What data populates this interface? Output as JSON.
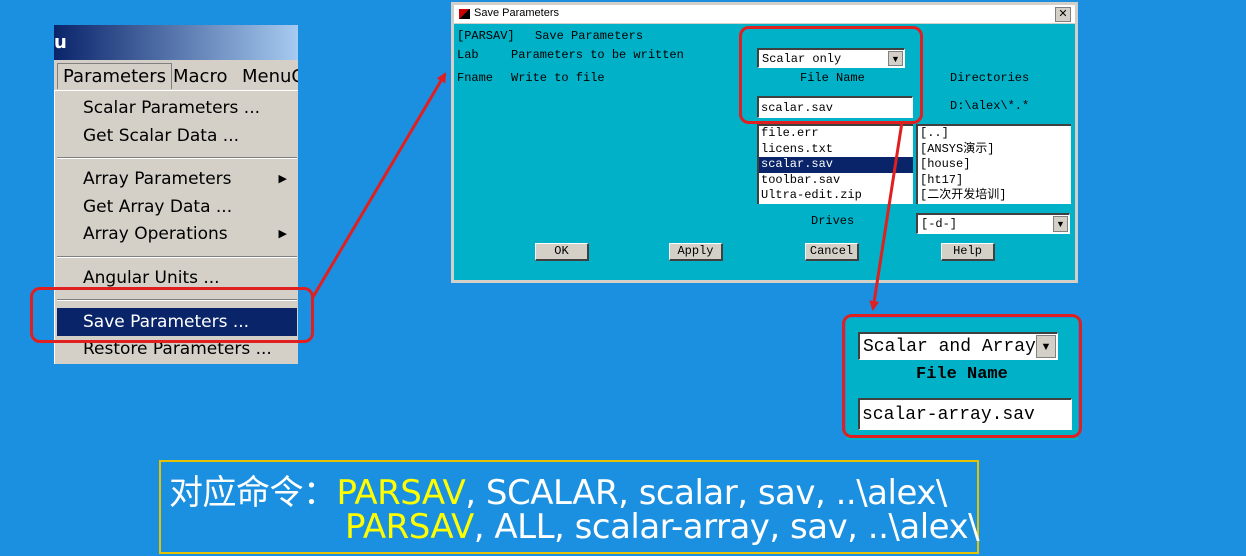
{
  "menu": {
    "title": "u",
    "menubar": [
      "Parameters",
      "Macro",
      "MenuC"
    ],
    "items": [
      {
        "label": "Scalar Parameters ..."
      },
      {
        "label": "Get Scalar Data ..."
      },
      {
        "label": "Array Parameters",
        "submenu": true
      },
      {
        "label": "Get Array Data ..."
      },
      {
        "label": "Array Operations",
        "submenu": true
      },
      {
        "label": "Angular Units ..."
      },
      {
        "label": "Save Parameters ...",
        "selected": true
      },
      {
        "label": "Restore Parameters ..."
      }
    ]
  },
  "dialog": {
    "title": "Save Parameters",
    "close_glyph": "✕",
    "cmd_code": "[PARSAV]",
    "cmd_desc": "Save Parameters",
    "lab_key": "Lab",
    "lab_desc": "Parameters to be written",
    "lab_value": "Scalar only",
    "fname_key": "Fname",
    "fname_desc": "Write to file",
    "file_name_header": "File Name",
    "directories_header": "Directories",
    "file_name_value": "scalar.sav",
    "current_dir": "D:\\alex\\*.*",
    "files": [
      "file.err",
      "licens.txt",
      "scalar.sav",
      "toolbar.sav",
      "Ultra-edit.zip"
    ],
    "selected_file": "scalar.sav",
    "directories": [
      "[..]",
      "[ANSYS演示]",
      "[house]",
      "[ht17]",
      "[二次开发培训]"
    ],
    "drives_label": "Drives",
    "drive_value": "[-d-]",
    "buttons": {
      "ok": "OK",
      "apply": "Apply",
      "cancel": "Cancel",
      "help": "Help"
    }
  },
  "inset": {
    "lab_value": "Scalar and Array",
    "file_name_header": "File Name",
    "file_name_value": "scalar-array.sav"
  },
  "command": {
    "prefix": "对应命令：",
    "line1_keyword": "PARSAV",
    "line1_rest": ", SCALAR, scalar, sav, ..\\alex\\",
    "line2_keyword": "PARSAV",
    "line2_rest": ", ALL, scalar-array, sav, ..\\alex\\"
  },
  "colors": {
    "background": "#1b8fe0",
    "dialog_body": "#00b1c8",
    "highlight_red": "#e02020",
    "keyword_yellow": "#ffff00",
    "caption_border": "#e6c300"
  }
}
